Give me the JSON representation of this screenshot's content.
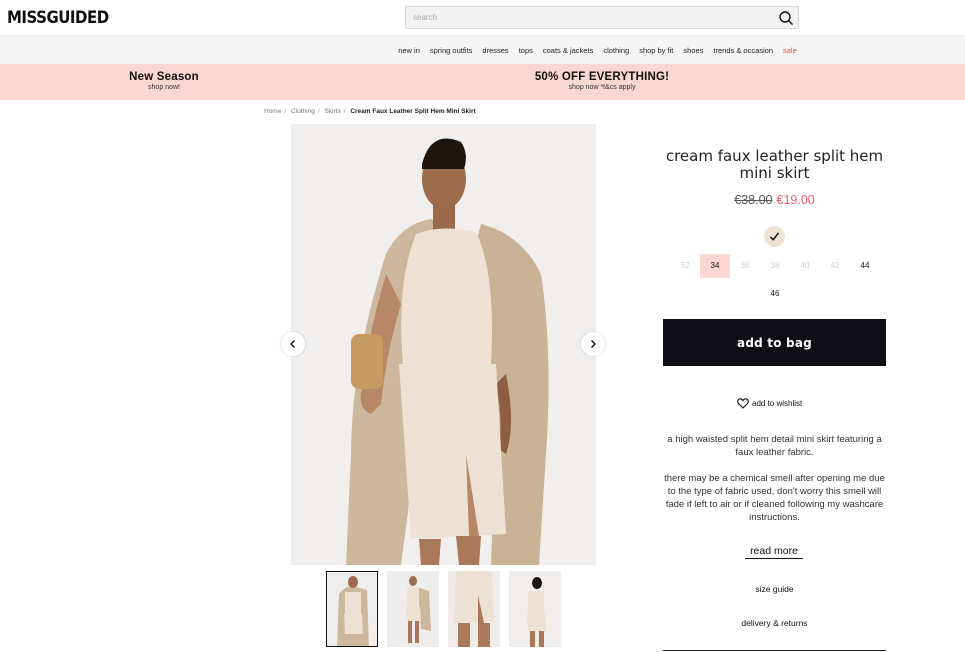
{
  "header": {
    "logo": "MISSGUIDED",
    "search_placeholder": "search"
  },
  "nav": {
    "items": [
      "new in",
      "spring outfits",
      "dresses",
      "tops",
      "coats & jackets",
      "clothing",
      "shop by fit",
      "shoes",
      "trends & occasion",
      "sale"
    ],
    "sale_color": "#e5533d"
  },
  "promo": {
    "left_title": "New Season",
    "left_sub": "shop now!",
    "right_title": "50% OFF EVERYTHING!",
    "right_sub": "shop now *t&cs apply",
    "bg_color": "#fbd7d2"
  },
  "breadcrumb": [
    "Home",
    "Clothing",
    "Skirts",
    "Cream Faux Leather Split Hem Mini Skirt"
  ],
  "product": {
    "title": "cream faux leather split hem mini skirt",
    "old_price": "€38.00",
    "new_price": "€19.00",
    "color_swatch": "#efe3d4",
    "sizes": [
      {
        "label": "32",
        "available": false,
        "selected": false
      },
      {
        "label": "34",
        "available": true,
        "selected": true
      },
      {
        "label": "36",
        "available": false,
        "selected": false
      },
      {
        "label": "38",
        "available": false,
        "selected": false
      },
      {
        "label": "40",
        "available": false,
        "selected": false
      },
      {
        "label": "42",
        "available": false,
        "selected": false
      },
      {
        "label": "44",
        "available": true,
        "selected": false
      },
      {
        "label": "46",
        "available": true,
        "selected": false
      }
    ],
    "add_to_bag": "add to bag",
    "wishlist": "add to wishlist",
    "desc_1": "a high waisted split hem detail mini skirt featuring a faux leather fabric.",
    "desc_2": "there may be a chemical smell after opening me due to the type of fabric used, don't worry this smell will fade if left to air or if cleaned following my washcare instructions.",
    "read_more": "read more",
    "size_guide": "size guide",
    "delivery": "delivery & returns"
  },
  "gallery": {
    "icons": [
      "chevron-left-icon",
      "chevron-right-icon"
    ],
    "thumbnail_count": 4,
    "active_thumbnail": 1
  }
}
